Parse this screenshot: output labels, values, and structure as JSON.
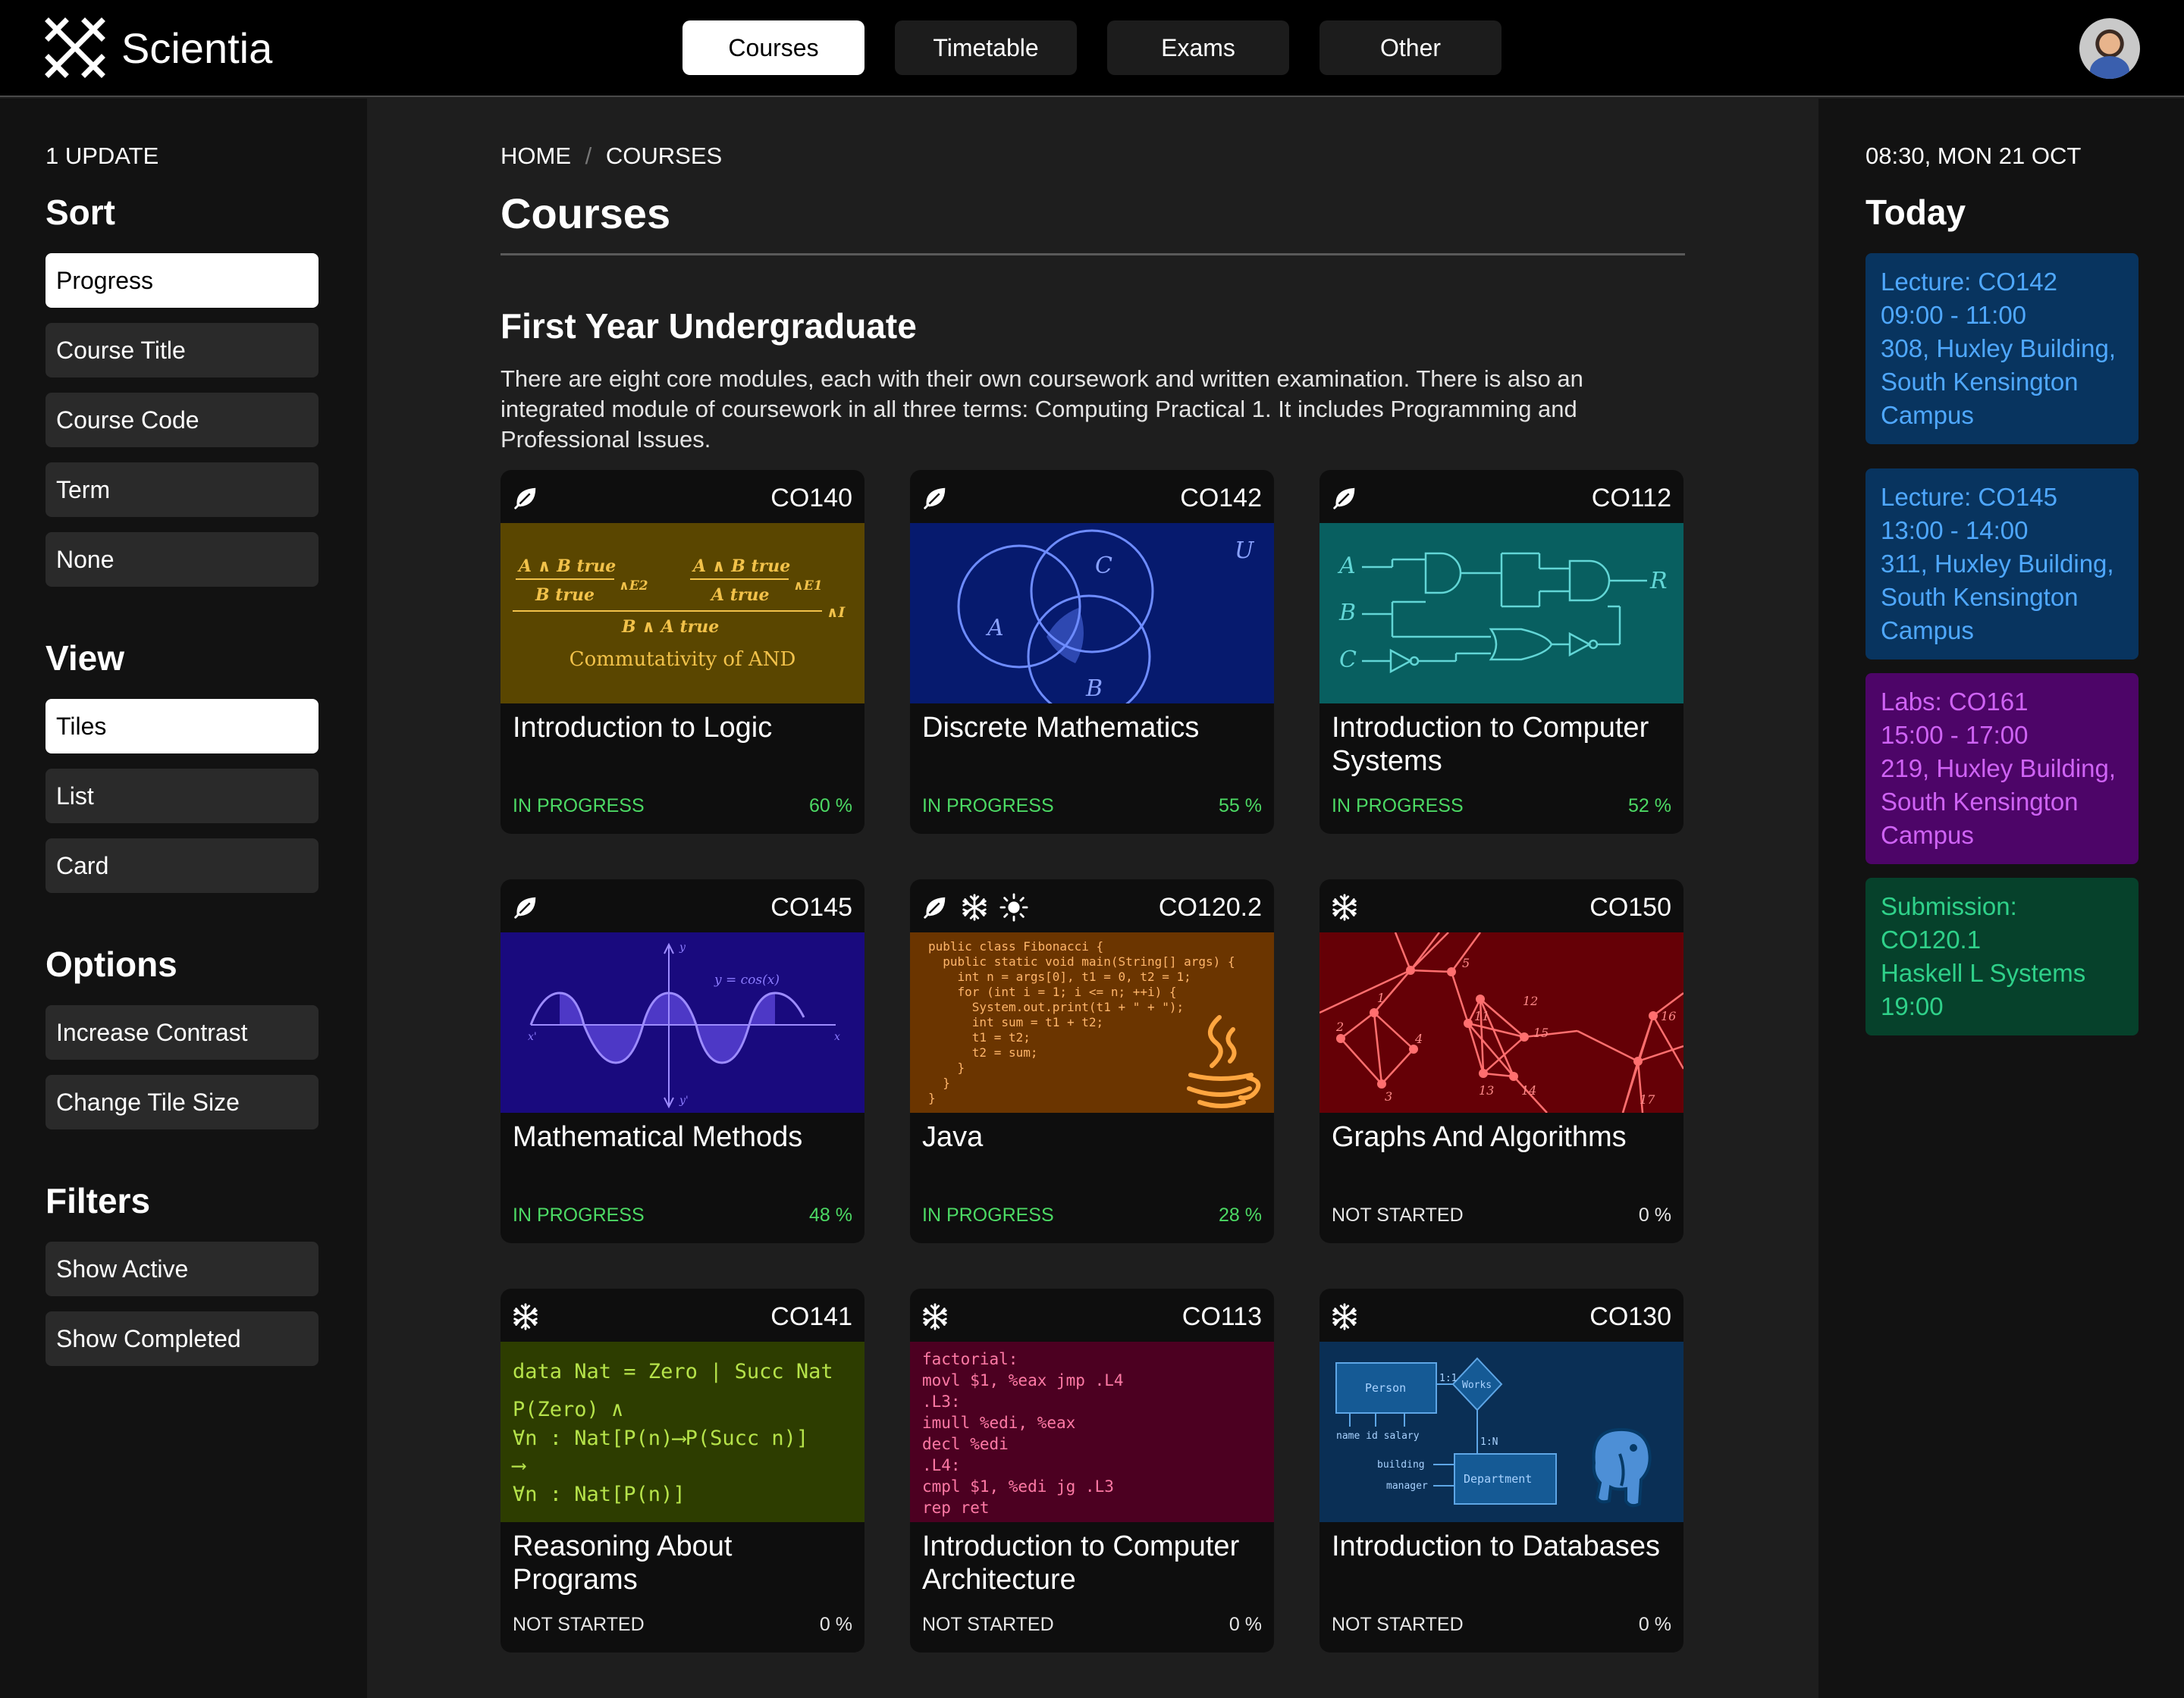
{
  "brand": "Scientia",
  "nav": [
    {
      "label": "Courses",
      "active": true
    },
    {
      "label": "Timetable"
    },
    {
      "label": "Exams"
    },
    {
      "label": "Other"
    }
  ],
  "left": {
    "updates": "1 UPDATE",
    "sort": {
      "heading": "Sort",
      "items": [
        "Progress",
        "Course Title",
        "Course Code",
        "Term",
        "None"
      ]
    },
    "view": {
      "heading": "View",
      "items": [
        "Tiles",
        "List",
        "Card"
      ]
    },
    "options": {
      "heading": "Options",
      "items": [
        "Increase Contrast",
        "Change Tile Size"
      ]
    },
    "filters": {
      "heading": "Filters",
      "items": [
        "Show Active",
        "Show Completed"
      ]
    }
  },
  "breadcrumb": {
    "home": "HOME",
    "sep": "/",
    "current": "COURSES"
  },
  "page_title": "Courses",
  "section": {
    "title": "First Year Undergraduate",
    "description": "There are eight core modules, each with their own coursework and written examination. There is also an integrated module of coursework in all three terms: Computing Practical 1. It includes Programming and Professional Issues."
  },
  "courses": [
    {
      "code": "CO140",
      "title": "Introduction to Logic",
      "status": "IN PROGRESS",
      "progress": "60 %",
      "terms": [
        "leaf-icon"
      ],
      "color": "#5a4600"
    },
    {
      "code": "CO142",
      "title": "Discrete Mathematics",
      "status": "IN PROGRESS",
      "progress": "55 %",
      "terms": [
        "leaf-icon"
      ],
      "color": "#061a6e"
    },
    {
      "code": "CO112",
      "title": "Introduction to Computer Systems",
      "status": "IN PROGRESS",
      "progress": "52 %",
      "terms": [
        "leaf-icon"
      ],
      "color": "#085f60"
    },
    {
      "code": "CO145",
      "title": "Mathematical Methods",
      "status": "IN PROGRESS",
      "progress": "48 %",
      "terms": [
        "leaf-icon"
      ],
      "color": "#190a7e"
    },
    {
      "code": "CO120.2",
      "title": "Java",
      "status": "IN PROGRESS",
      "progress": "28 %",
      "terms": [
        "leaf-icon",
        "snowflake-icon",
        "sun-icon"
      ],
      "color": "#6b3500"
    },
    {
      "code": "CO150",
      "title": "Graphs And Algorithms",
      "status": "NOT STARTED",
      "progress": "0 %",
      "terms": [
        "snowflake-icon"
      ],
      "color": "#650006"
    },
    {
      "code": "CO141",
      "title": "Reasoning About Programs",
      "status": "NOT STARTED",
      "progress": "0 %",
      "terms": [
        "snowflake-icon"
      ],
      "color": "#2d3d00"
    },
    {
      "code": "CO113",
      "title": "Introduction to Computer Architecture",
      "status": "NOT STARTED",
      "progress": "0 %",
      "terms": [
        "snowflake-icon"
      ],
      "color": "#4c0021"
    },
    {
      "code": "CO130",
      "title": "Introduction to Databases",
      "status": "NOT STARTED",
      "progress": "0 %",
      "terms": [
        "snowflake-icon"
      ],
      "color": "#0a2f55"
    }
  ],
  "art": {
    "co140": {
      "l1": "A ∧ B true",
      "l2": "B true",
      "r1": "A ∧ B true",
      "r2": "A true",
      "e2": "∧E2",
      "e1": "∧E1",
      "c": "B ∧ A true",
      "i": "∧I",
      "caption": "Commutativity of AND"
    },
    "co142": {
      "a": "A",
      "b": "B",
      "c": "C",
      "u": "U"
    },
    "co112": {
      "a": "A",
      "b": "B",
      "c": "C",
      "r": "R"
    },
    "co145": {
      "label": "y = cos(x)",
      "y": "y",
      "yp": "y'",
      "x": "x",
      "xp": "x'"
    },
    "co120": [
      "public class Fibonacci {",
      "  public static void main(String[] args) {",
      "    int n = args[0], t1 = 0, t2 = 1;",
      "    for (int i = 1; i <= n; ++i) {",
      "      System.out.print(t1 + \" + \");",
      "      int sum = t1 + t2;",
      "      t1 = t2;",
      "      t2 = sum;",
      "    }",
      "  }",
      "}"
    ],
    "co150": [
      "1",
      "2",
      "3",
      "4",
      "5",
      "11",
      "12",
      "13",
      "14",
      "15",
      "16",
      "17"
    ],
    "co141": [
      "data Nat = Zero | Succ Nat",
      "P(Zero) ∧",
      "∀n : Nat[P(n)⟶P(Succ n)]",
      "⟶",
      "∀n : Nat[P(n)]"
    ],
    "co113": [
      "factorial:",
      "    movl $1, %eax jmp .L4",
      ".L3:",
      "    imull %edi, %eax",
      "    decl %edi",
      ".L4:",
      "    cmpl $1, %edi jg .L3",
      "    rep ret"
    ],
    "co130": {
      "person": "Person",
      "works": "Works",
      "department": "Department",
      "r1": "1:1",
      "rn": "1:N",
      "attrs": "name id salary",
      "building": "building",
      "manager": "manager"
    }
  },
  "right": {
    "datetime": "08:30, MON 21 OCT",
    "heading": "Today",
    "events": [
      {
        "type": "Lecture:",
        "code": "CO142",
        "time": "09:00 - 11:00",
        "location": "308, Huxley Building, South Kensington Campus",
        "bg": "#08345f",
        "fg": "#4fa8ff"
      },
      {
        "type": "Lecture:",
        "code": "CO145",
        "time": "13:00 - 14:00",
        "location": "311, Huxley Building, South Kensington Campus",
        "bg": "#08345f",
        "fg": "#4fa8ff"
      },
      {
        "type": "Labs:",
        "code": "CO161",
        "time": "15:00 - 17:00",
        "location": "219, Huxley Building, South Kensington Campus",
        "bg": "#4d0568",
        "fg": "#cf63f5"
      },
      {
        "type": "Submission:",
        "code": "CO120.1",
        "time": "19:00",
        "location": "Haskell L Systems",
        "bg": "#06412b",
        "fg": "#2fd18a"
      }
    ]
  }
}
